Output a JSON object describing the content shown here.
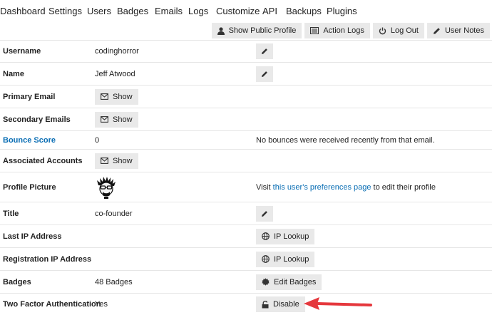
{
  "nav": {
    "items": [
      "Dashboard",
      "Settings",
      "Users",
      "Badges",
      "Emails",
      "Logs",
      "Customize",
      "API",
      "Backups",
      "Plugins"
    ]
  },
  "actions": {
    "show_public_profile": "Show Public Profile",
    "action_logs": "Action Logs",
    "log_out": "Log Out",
    "user_notes": "User Notes"
  },
  "fields": {
    "username": {
      "label": "Username",
      "value": "codinghorror"
    },
    "name": {
      "label": "Name",
      "value": "Jeff Atwood"
    },
    "primary_email": {
      "label": "Primary Email",
      "button": "Show"
    },
    "secondary_emails": {
      "label": "Secondary Emails",
      "button": "Show"
    },
    "bounce_score": {
      "label": "Bounce Score",
      "value": "0",
      "note": "No bounces were received recently from that email."
    },
    "associated_accounts": {
      "label": "Associated Accounts",
      "button": "Show"
    },
    "profile_picture": {
      "label": "Profile Picture",
      "note_prefix": "Visit ",
      "note_link": "this user's preferences page",
      "note_suffix": " to edit their profile"
    },
    "title": {
      "label": "Title",
      "value": "co-founder"
    },
    "last_ip": {
      "label": "Last IP Address",
      "button": "IP Lookup"
    },
    "registration_ip": {
      "label": "Registration IP Address",
      "button": "IP Lookup"
    },
    "badges": {
      "label": "Badges",
      "value": "48 Badges",
      "button": "Edit Badges"
    },
    "two_factor": {
      "label": "Two Factor Authentication",
      "value": "Yes",
      "button": "Disable"
    }
  },
  "colors": {
    "link": "#0a6eb4",
    "button_bg": "#e9e9e9",
    "arrow": "#e5383d",
    "divider": "#e6e6e6"
  }
}
